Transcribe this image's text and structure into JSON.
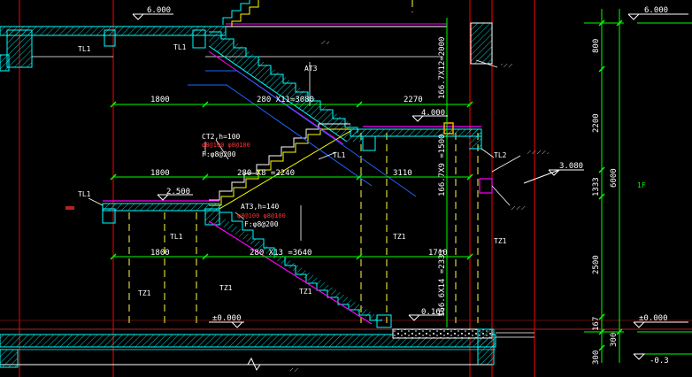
{
  "levels": {
    "top_left": "6.000",
    "top_right": "6.000",
    "landing_mid": "4.000",
    "landing_low": "2.500",
    "ground": "±0.000",
    "ground_right": "±0.000",
    "step": "0.167",
    "below": "-0.3",
    "beam": "3.080"
  },
  "dims": {
    "run_1800_a": "1800",
    "run_1800_b": "1800",
    "run_1800_c": "1800",
    "flight_upper": "280 X11=3080",
    "flight_mid": "280 X8 =2240",
    "flight_low": "280 X13 =3640",
    "d2270": "2270",
    "d3110": "3110",
    "d1710": "1710",
    "v_upper": "166.7X12=2000",
    "v_mid": "166.7X9 =1500",
    "v_low": "166.6X14 =2333",
    "r800": "800",
    "r2200": "2200",
    "r1333": "1333",
    "r6000": "6000",
    "r2500": "2500",
    "r167": "167",
    "r300": "300",
    "r300b": "300"
  },
  "labels": {
    "tl1_a": "TL1",
    "tl1_b": "TL1",
    "tl1_c": "TL1",
    "tl1_d": "TL1",
    "tl1_e": "TL1",
    "tl2": "TL2",
    "at3": "AT3",
    "ct2": "CT2,h=100",
    "f_ct2": "F:φ8@200",
    "at3b": "AT3,h=140",
    "f_at3b": "F:φ8@200",
    "tz1_a": "TZ1",
    "tz1_b": "TZ1",
    "tz1_c": "TZ1",
    "tz1_d": "TZ1",
    "tz1_e": "TZ1",
    "axis_1f": "1F",
    "break_mark": "〰"
  },
  "rebar": {
    "ct2": "φ8@100 φ8@100",
    "at3b": "φ8@100 φ8@100"
  },
  "colors": {
    "background": "#000000",
    "wall": "#00ffff",
    "dim": "#00ff00",
    "text": "#ffffff",
    "stair_edge": "#ffff00",
    "landing": "#ff00ff",
    "axis": "#ff0000",
    "column": "#ffff00",
    "pipe": "#1e64ff"
  }
}
